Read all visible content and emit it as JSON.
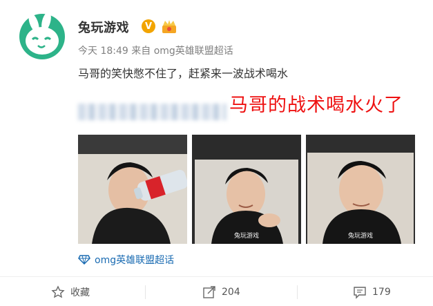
{
  "post": {
    "username": "兔玩游戏",
    "v_badge": "V",
    "time": "今天 18:49",
    "from_label": "来自",
    "source": "omg英雄联盟超话",
    "text": "马哥的笑快憋不住了，赶紧来一波战术喝水",
    "overlay_caption": "马哥的战术喝水火了",
    "watermark": "兔玩游戏",
    "topic": "omg英雄联盟超话"
  },
  "actions": {
    "favorite": "收藏",
    "repost_count": "204",
    "comment_count": "179"
  },
  "icons": {
    "avatar": "bunny-logo-icon",
    "verified": "v-badge-icon",
    "vip": "crown-badge-icon",
    "topic": "diamond-topic-icon",
    "favorite": "star-icon",
    "repost": "share-arrow-icon",
    "comment": "comment-icon"
  },
  "colors": {
    "brand_green": "#2db389",
    "accent_red": "#ee1111",
    "link_blue": "#1a6bb2",
    "verified_orange": "#f2a400"
  }
}
